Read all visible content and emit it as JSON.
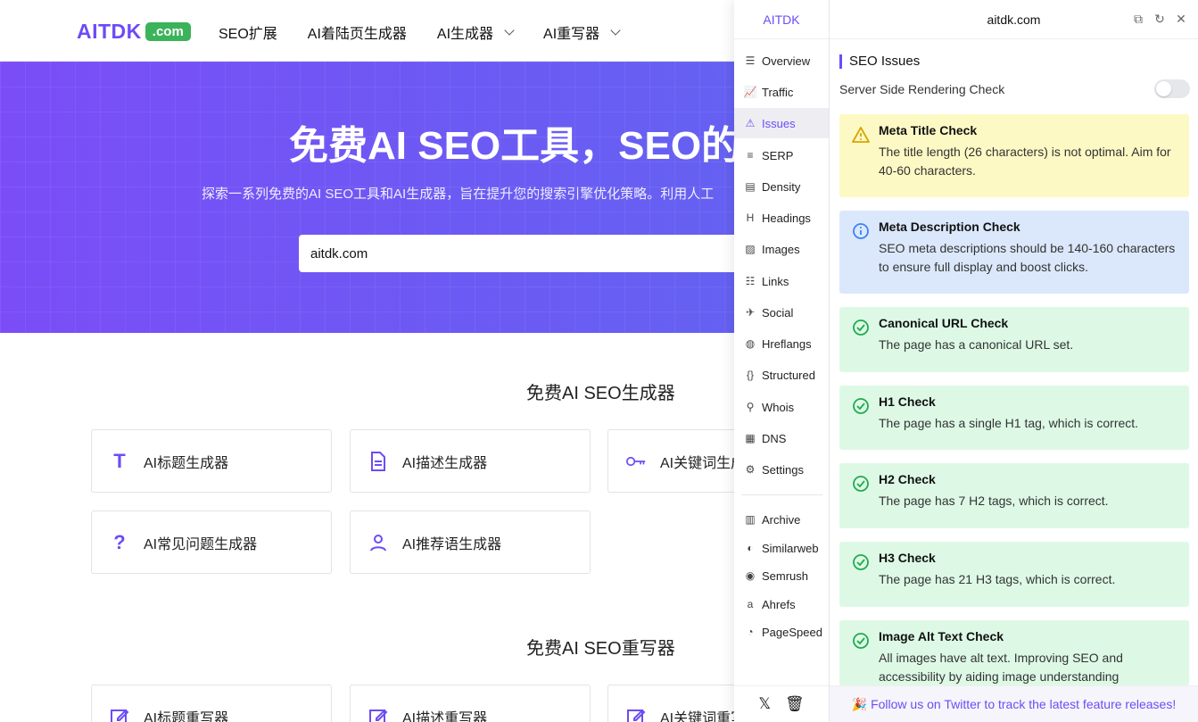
{
  "site": {
    "logo": {
      "text": "AITDK",
      "badge": ".com"
    },
    "nav": [
      {
        "label": "SEO扩展"
      },
      {
        "label": "AI着陆页生成器"
      },
      {
        "label": "AI生成器"
      },
      {
        "label": "AI重写器"
      }
    ],
    "hero": {
      "title": "免费AI SEO工具，SEO的",
      "subtitle": "探索一系列免费的AI SEO工具和AI生成器，旨在提升您的搜索引擎优化策略。利用人工",
      "search_value": "aitdk.com"
    },
    "generators_title": "免费AI SEO生成器",
    "generators": [
      {
        "label": "AI标题生成器",
        "icon": "title-t-icon"
      },
      {
        "label": "AI描述生成器",
        "icon": "document-icon"
      },
      {
        "label": "AI关键词生成器",
        "icon": "key-icon"
      },
      {
        "label": "AI常见问题生成器",
        "icon": "question-icon"
      },
      {
        "label": "AI推荐语生成器",
        "icon": "person-icon"
      }
    ],
    "rewriters_title": "免费AI SEO重写器",
    "rewriters": [
      {
        "label": "AI标题重写器",
        "icon": "edit-icon"
      },
      {
        "label": "AI描述重写器",
        "icon": "edit-icon"
      },
      {
        "label": "AI关键词重写器",
        "icon": "edit-icon"
      }
    ]
  },
  "extension": {
    "brand": "AITDK",
    "domain": "aitdk.com",
    "sidebar": [
      {
        "label": "Overview",
        "icon": "list-icon"
      },
      {
        "label": "Traffic",
        "icon": "chart-icon"
      },
      {
        "label": "Issues",
        "icon": "warning-icon",
        "active": true
      },
      {
        "label": "SERP",
        "icon": "serp-icon"
      },
      {
        "label": "Density",
        "icon": "density-icon"
      },
      {
        "label": "Headings",
        "icon": "heading-icon"
      },
      {
        "label": "Images",
        "icon": "image-icon"
      },
      {
        "label": "Links",
        "icon": "links-icon"
      },
      {
        "label": "Social",
        "icon": "social-icon"
      },
      {
        "label": "Hreflangs",
        "icon": "globe-icon"
      },
      {
        "label": "Structured",
        "icon": "braces-icon"
      },
      {
        "label": "Whois",
        "icon": "user-search-icon"
      },
      {
        "label": "DNS",
        "icon": "server-icon"
      },
      {
        "label": "Settings",
        "icon": "gear-icon"
      }
    ],
    "sidebar_external": [
      {
        "label": "Archive",
        "icon": "archive-icon"
      },
      {
        "label": "Similarweb",
        "icon": "similarweb-icon"
      },
      {
        "label": "Semrush",
        "icon": "semrush-icon"
      },
      {
        "label": "Ahrefs",
        "icon": "ahrefs-icon"
      },
      {
        "label": "PageSpeed",
        "icon": "pagespeed-icon"
      }
    ],
    "section_title": "SEO Issues",
    "ssr_label": "Server Side Rendering Check",
    "issues": [
      {
        "status": "warn",
        "title": "Meta Title Check",
        "desc": "The title length (26 characters) is not optimal. Aim for 40-60 characters."
      },
      {
        "status": "info",
        "title": "Meta Description Check",
        "desc": "SEO meta descriptions should be 140-160 characters to ensure full display and boost clicks."
      },
      {
        "status": "ok",
        "title": "Canonical URL Check",
        "desc": "The page has a canonical URL set."
      },
      {
        "status": "ok",
        "title": "H1 Check",
        "desc": "The page has a single H1 tag, which is correct."
      },
      {
        "status": "ok",
        "title": "H2 Check",
        "desc": "The page has 7 H2 tags, which is correct."
      },
      {
        "status": "ok",
        "title": "H3 Check",
        "desc": "The page has 21 H3 tags, which is correct."
      },
      {
        "status": "ok",
        "title": "Image Alt Text Check",
        "desc": "All images have alt text. Improving SEO and accessibility by aiding image understanding"
      }
    ],
    "footer": "🎉 Follow us on Twitter to track the latest feature releases!",
    "colors": {
      "accent": "#6d4cf5",
      "warn_bg": "#fdf9c4",
      "info_bg": "#dbe8fb",
      "ok_bg": "#ddf9e5",
      "ok": "#22a94f",
      "warn": "#d9a400",
      "info": "#3b82f6"
    }
  }
}
